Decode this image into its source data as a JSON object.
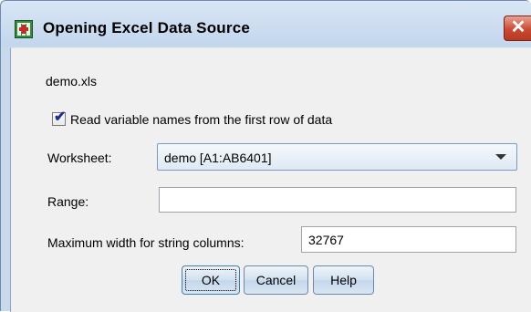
{
  "dialog": {
    "title": "Opening Excel Data Source",
    "close_symbol": "✕",
    "filename": "demo.xls",
    "checkbox": {
      "label": "Read variable names from the first row of data",
      "checked": true
    },
    "worksheet": {
      "label": "Worksheet:",
      "selected": "demo [A1:AB6401]"
    },
    "range": {
      "label": "Range:",
      "value": ""
    },
    "max_width": {
      "label": "Maximum width for string columns:",
      "value": "32767"
    },
    "buttons": {
      "ok": "OK",
      "cancel": "Cancel",
      "help": "Help"
    }
  },
  "icons": {
    "app": "spss-data-icon",
    "close": "close-icon",
    "check": "checkmark-icon",
    "dropdown": "chevron-down-icon"
  },
  "colors": {
    "frame": "#c8d9ec",
    "client": "#f0f0f0",
    "close_button": "#c94a34",
    "check_mark": "#1a2f9c"
  }
}
